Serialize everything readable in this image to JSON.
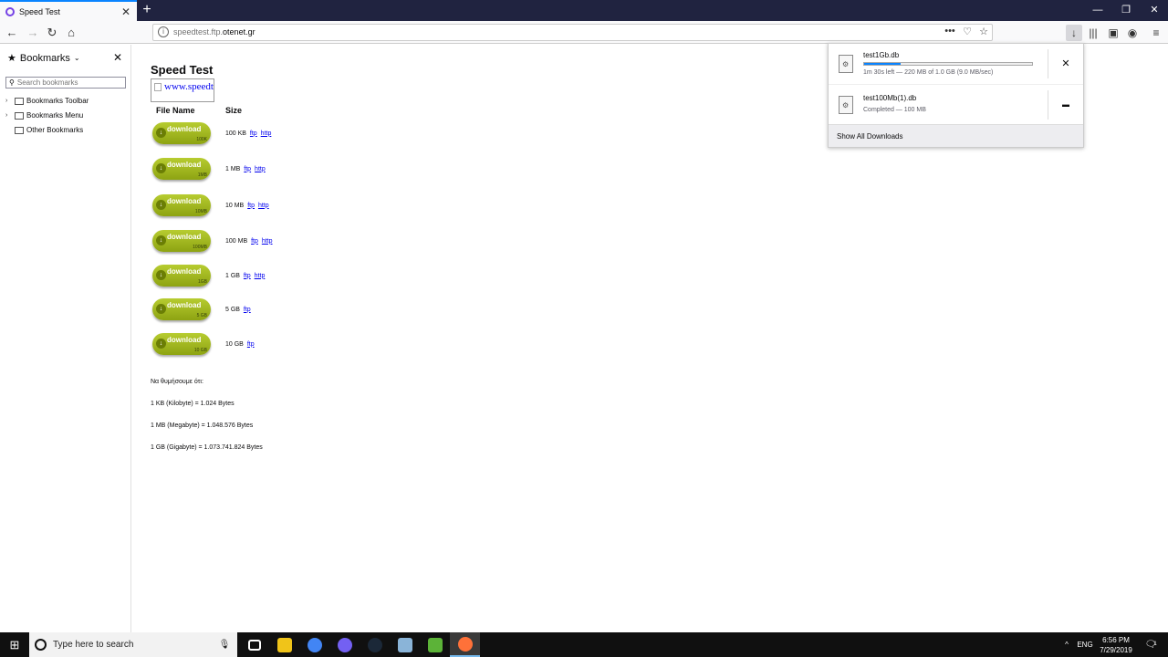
{
  "browser": {
    "tab_title": "Speed Test",
    "tab_close": "✕",
    "new_tab": "+",
    "url_host_prefix": "speedtest.ftp.",
    "url_host_main": "otenet.gr",
    "window_controls": [
      "—",
      "❐",
      "✕"
    ]
  },
  "sidebar": {
    "title": "Bookmarks",
    "close": "✕",
    "search_placeholder": "Search bookmarks",
    "items": [
      {
        "label": "Bookmarks Toolbar",
        "expandable": true
      },
      {
        "label": "Bookmarks Menu",
        "expandable": true
      },
      {
        "label": "Other Bookmarks",
        "expandable": false
      }
    ]
  },
  "page": {
    "title": "Speed Test",
    "banner_text": "www.speedtest",
    "col_file": "File Name",
    "col_size": "Size",
    "button_word": "download",
    "rows": [
      {
        "badge": "100K",
        "size": "100 KB",
        "ftp": "ftp",
        "http": "http"
      },
      {
        "badge": "1MB",
        "size": "1 MB",
        "ftp": "ftp",
        "http": "http"
      },
      {
        "badge": "10MB",
        "size": "10 MB",
        "ftp": "ftp",
        "http": "http"
      },
      {
        "badge": "100MB",
        "size": "100 MB",
        "ftp": "ftp",
        "http": "http"
      },
      {
        "badge": "1GB",
        "size": "1 GB",
        "ftp": "ftp",
        "http": "http"
      },
      {
        "badge": "5 GB",
        "size": "5 GB",
        "ftp": "ftp",
        "http": null
      },
      {
        "badge": "10 GB",
        "size": "10 GB",
        "ftp": "ftp",
        "http": null
      }
    ],
    "note_lines": [
      "Να θυμήσουμε ότι:",
      "1 KB (Kilobyte) = 1.024 Bytes",
      "1 MB (Megabyte) = 1.048.576 Bytes",
      "1 GB (Gigabyte) = 1.073.741.824 Bytes"
    ]
  },
  "downloads": {
    "items": [
      {
        "name": "test1Gb.db",
        "status": "1m 30s left — 220 MB of 1.0 GB (9.0 MB/sec)",
        "progress": 0.22,
        "action_icon": "cancel-icon",
        "action": "✕"
      },
      {
        "name": "test100Mb(1).db",
        "status": "Completed — 100 MB",
        "progress": null,
        "action_icon": "folder-icon",
        "action": "▬"
      }
    ],
    "footer": "Show All Downloads"
  },
  "taskbar": {
    "search_placeholder": "Type here to search",
    "apps": [
      {
        "name": "task-view",
        "color": "#ffffff"
      },
      {
        "name": "file-explorer",
        "color": "#f0c419"
      },
      {
        "name": "chrome",
        "color": "#4285f4"
      },
      {
        "name": "viber",
        "color": "#7360f2"
      },
      {
        "name": "steam",
        "color": "#1b2838"
      },
      {
        "name": "notepad",
        "color": "#8ab4d8"
      },
      {
        "name": "utorrent",
        "color": "#5cb338"
      },
      {
        "name": "firefox",
        "color": "#ff7139"
      }
    ],
    "language": "ENG",
    "time": "6:56 PM",
    "date": "7/29/2019",
    "notification_count": "1"
  },
  "colors": {
    "accent": "#0a84ff",
    "tab_strip": "#202340",
    "button_green": "#9ab21c"
  }
}
